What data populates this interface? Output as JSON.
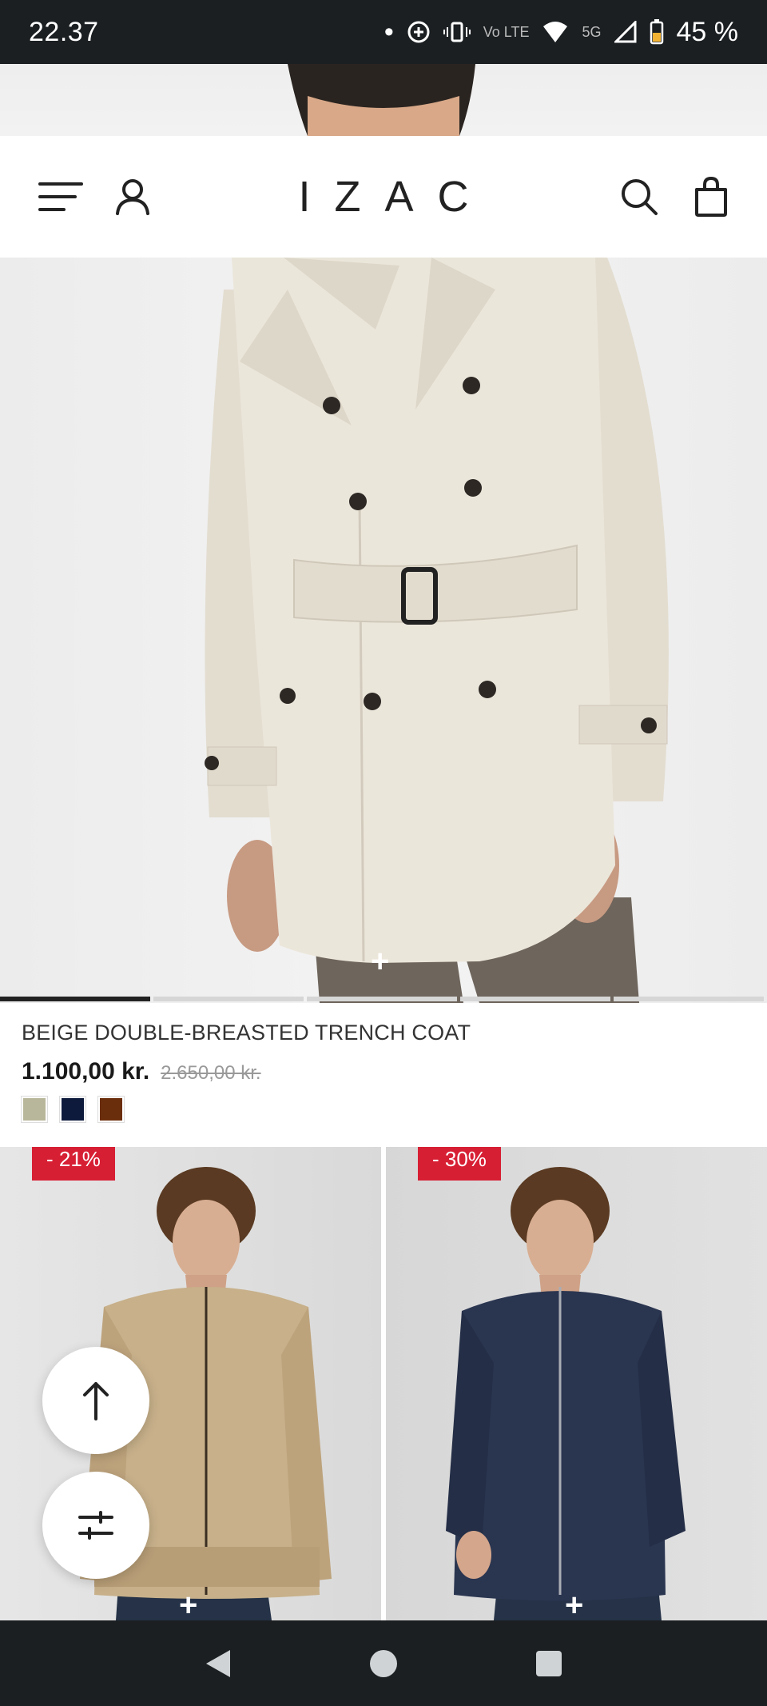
{
  "status_bar": {
    "time": "22.37",
    "battery": "45 %",
    "network": "5G",
    "volte_label": "Vo LTE"
  },
  "header": {
    "brand": "IZAC",
    "icons": [
      "menu-icon",
      "account-icon",
      "search-icon",
      "bag-icon"
    ]
  },
  "hero": {
    "plus_label": "+",
    "carousel_slides": 5,
    "active_slide": 1
  },
  "product": {
    "title": "BEIGE DOUBLE-BREASTED TRENCH COAT",
    "price": "1.100,00 kr.",
    "old_price": "2.650,00 kr.",
    "swatches": [
      "#b9b79b",
      "#0e1a3c",
      "#6b2e0c"
    ]
  },
  "grid": {
    "items": [
      {
        "badge": "- 21%",
        "plus_label": "+"
      },
      {
        "badge": "- 30%",
        "plus_label": "+"
      }
    ]
  },
  "colors": {
    "accent_red": "#d71f34",
    "system_bar": "#1b1f22",
    "coat_beige": "#e7e2d6",
    "jacket_tan": "#c7b08a",
    "jacket_navy": "#2a3550"
  }
}
